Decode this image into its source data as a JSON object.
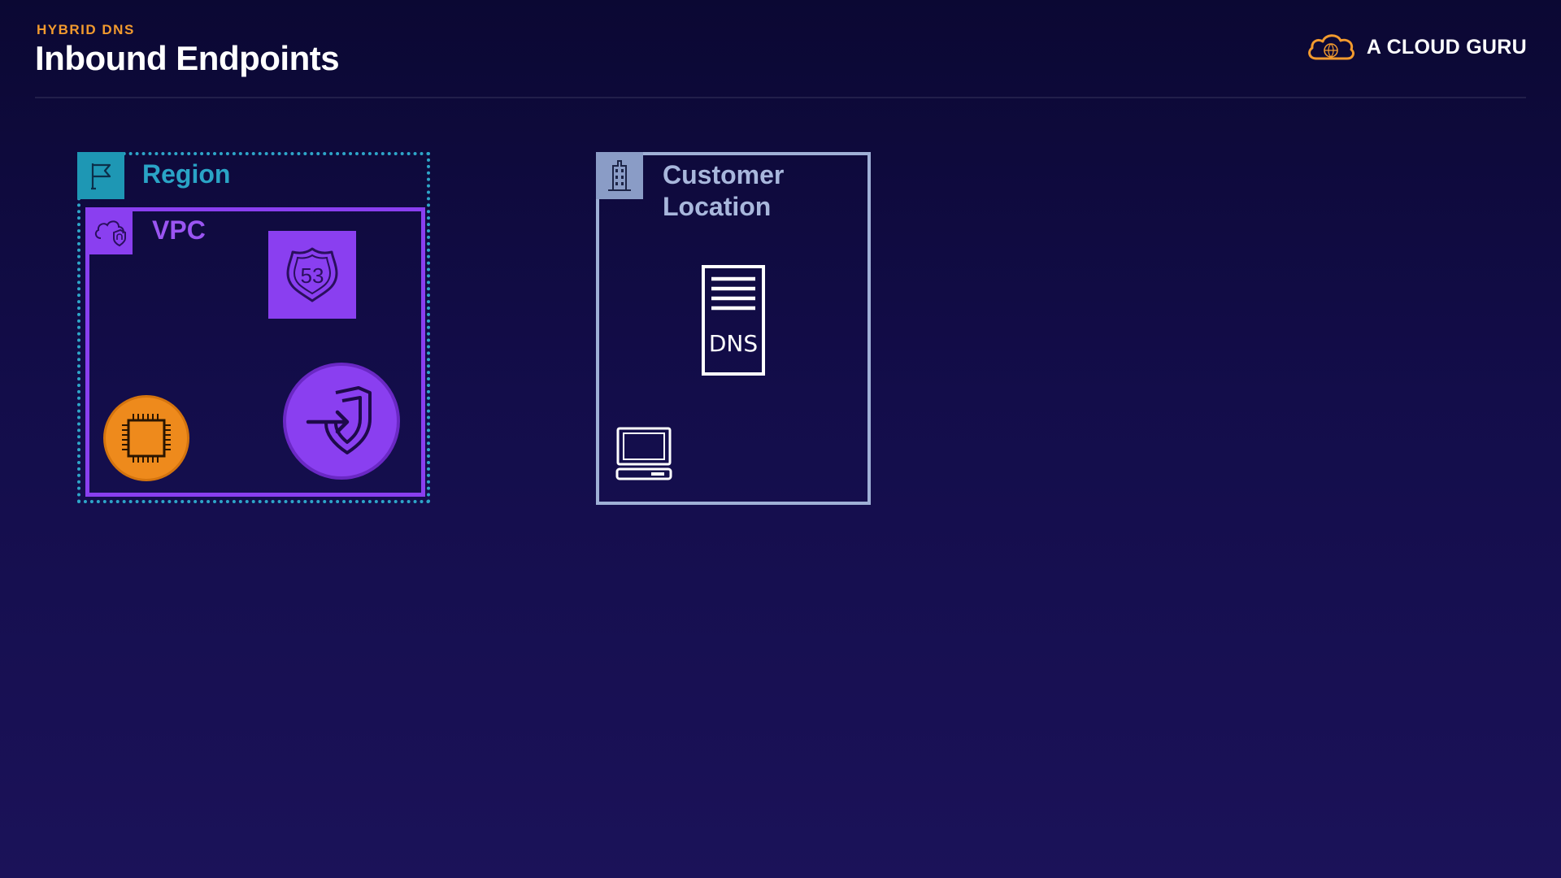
{
  "header": {
    "eyebrow": "HYBRID DNS",
    "title": "Inbound Endpoints",
    "brand": "A CLOUD GURU"
  },
  "diagram": {
    "region": {
      "label": "Region",
      "icon": "flag-icon",
      "color": "#2ea6c9"
    },
    "vpc": {
      "label": "VPC",
      "icon": "cloud-shield-icon",
      "color": "#8a3ff0"
    },
    "route53": {
      "icon": "route53-icon",
      "text": "53"
    },
    "ec2": {
      "icon": "chip-icon",
      "color": "#ee8a1c"
    },
    "inbound_endpoint": {
      "icon": "shield-arrow-icon"
    },
    "customer_location": {
      "label_line1": "Customer",
      "label_line2": "Location",
      "icon": "building-icon",
      "color": "#9fb0d6"
    },
    "dns_server": {
      "icon": "server-icon",
      "text": "DNS"
    },
    "client": {
      "icon": "laptop-icon"
    }
  },
  "colors": {
    "accent_orange": "#f29a2e",
    "background": "#130d4a"
  }
}
